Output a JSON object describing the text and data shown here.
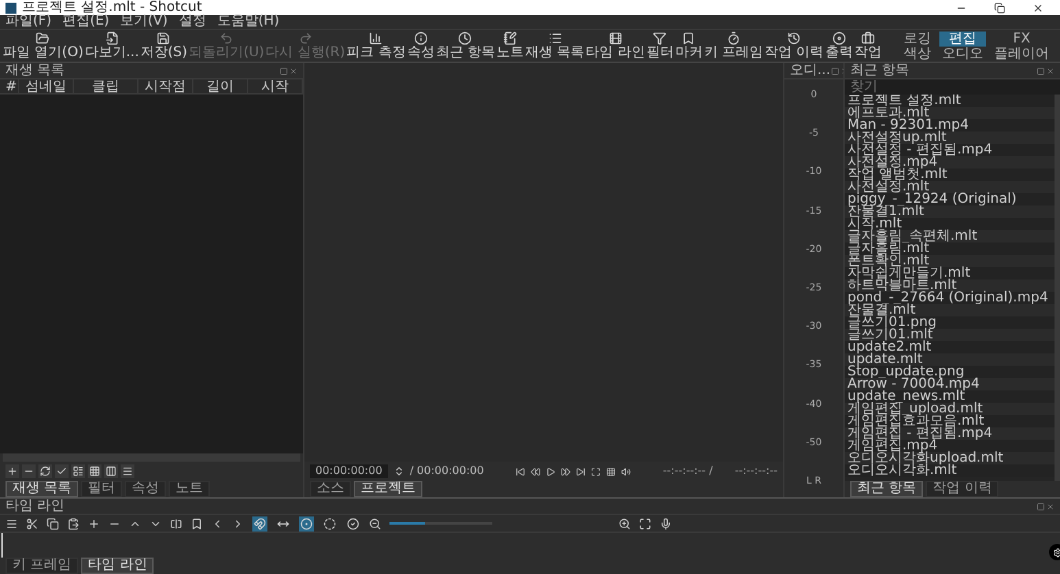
{
  "window": {
    "title": "프로젝트 설정.mlt - Shotcut"
  },
  "menu": [
    "파일(F)",
    "편집(E)",
    "보기(V)",
    "설정",
    "도움말(H)"
  ],
  "toolbar": [
    {
      "label": "파일 열기(O)",
      "disabled": false
    },
    {
      "label": "다보기...",
      "disabled": false
    },
    {
      "label": "저장(S)",
      "disabled": false
    },
    {
      "label": "되돌리기(U)",
      "disabled": true
    },
    {
      "label": "다시 실행(R)",
      "disabled": true
    },
    {
      "label": "피크 측정",
      "disabled": false
    },
    {
      "label": "속성",
      "disabled": false
    },
    {
      "label": "최근 항목",
      "disabled": false
    },
    {
      "label": "노트",
      "disabled": false
    },
    {
      "label": "재생 목록",
      "disabled": false
    },
    {
      "label": "타임 라인",
      "disabled": false
    },
    {
      "label": "필터",
      "disabled": false
    },
    {
      "label": "마커",
      "disabled": false
    },
    {
      "label": "키 프레임",
      "disabled": false
    },
    {
      "label": "작업 이력",
      "disabled": false
    },
    {
      "label": "출력",
      "disabled": false
    },
    {
      "label": "작업",
      "disabled": false
    }
  ],
  "workspaces": [
    {
      "label": "로깅",
      "selected": false
    },
    {
      "label": "편집",
      "selected": true
    },
    {
      "label": "FX",
      "selected": false
    },
    {
      "label": "색상",
      "selected": false
    },
    {
      "label": "오디오",
      "selected": false
    },
    {
      "label": "플레이어",
      "selected": false
    }
  ],
  "playlist": {
    "title": "재생 목록",
    "columns": [
      "#",
      "섬네일",
      "클립",
      "시작점",
      "길이",
      "시작"
    ],
    "tabs": [
      {
        "label": "재생 목록",
        "selected": true
      },
      {
        "label": "필터",
        "selected": false
      },
      {
        "label": "속성",
        "selected": false
      },
      {
        "label": "노트",
        "selected": false
      }
    ]
  },
  "player": {
    "timecode": "00:00:00:00",
    "duration": "/ 00:00:00:00",
    "in_point": "--:--:--:-- /",
    "out_point": "--:--:--:--",
    "tabs": [
      {
        "label": "소스",
        "selected": false
      },
      {
        "label": "프로젝트",
        "selected": true
      }
    ]
  },
  "audio_meter": {
    "title": "오디...",
    "scale": [
      "0",
      "-5",
      "-10",
      "-15",
      "-20",
      "-25",
      "-30",
      "-35",
      "-40",
      "-50"
    ],
    "channels": "L R"
  },
  "recent": {
    "title": "최근 항목",
    "search": {
      "placeholder": "찾기"
    },
    "items": [
      "프로젝트 설정.mlt",
      "에프토과.mlt",
      "Man - 92301.mp4",
      "사전설정up.mlt",
      "사전설정 - 편집됨.mp4",
      "사전설정.mp4",
      "작업 앨범첫.mlt",
      "사전설정.mlt",
      "piggy_-_12924 (Original)",
      "잔물결1.mlt",
      "시작.mlt",
      "글자흘림_속편체.mlt",
      "글자흘림.mlt",
      "폰트확인.mlt",
      "자막쉽게만들기.mlt",
      "하트막블마트.mlt",
      "pond_-_27664 (Original).mp4",
      "잔물결.mlt",
      "글쓰기01.png",
      "글쓰기01.mlt",
      "update2.mlt",
      "update.mlt",
      "Stop_update.png",
      "Arrow - 70004.mp4",
      "update_news.mlt",
      "게임편집_upload.mlt",
      "게임편집효과모음.mlt",
      "게임편집 - 편집됨.mp4",
      "게임편집.mp4",
      "오디오시각화upload.mlt",
      "오디오시각화.mlt"
    ],
    "tabs": [
      {
        "label": "최근 항목",
        "selected": true
      },
      {
        "label": "작업 이력",
        "selected": false
      }
    ]
  },
  "timeline": {
    "title": "타임 라인",
    "toggles": [
      {
        "on": true
      },
      {
        "on": false
      },
      {
        "on": true
      },
      {
        "on": false
      },
      {
        "on": false
      }
    ],
    "zoom": {
      "level": 0.35
    }
  },
  "bottom_tabs": [
    {
      "label": "키 프레임",
      "selected": false
    },
    {
      "label": "타임 라인",
      "selected": true
    }
  ]
}
